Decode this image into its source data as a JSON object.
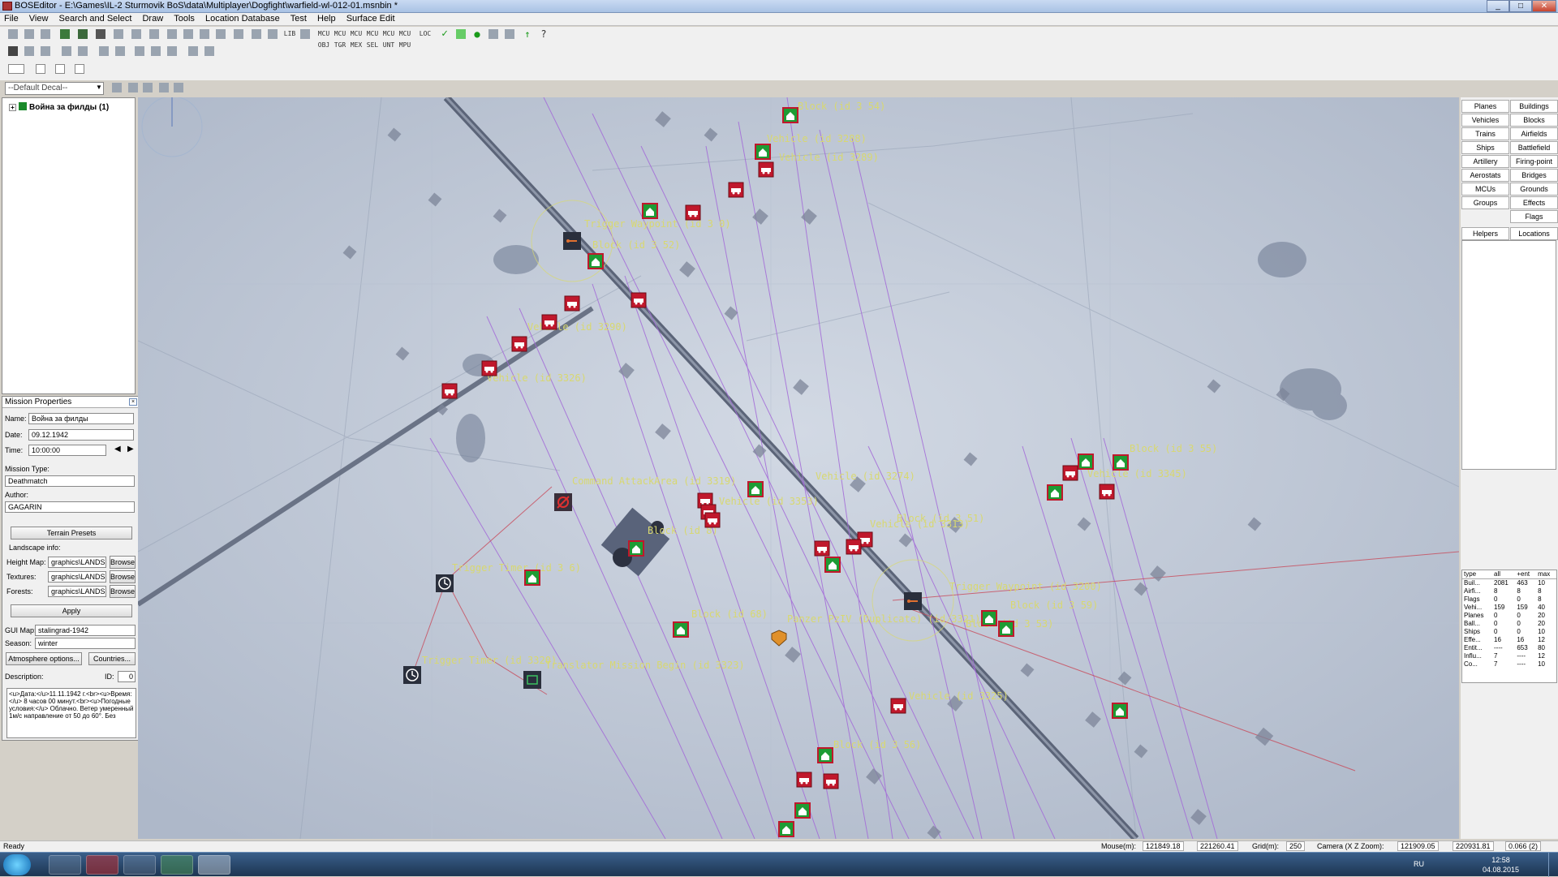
{
  "window": {
    "title": "BOSEditor - E:\\Games\\IL-2 Sturmovik BoS\\data\\Multiplayer\\Dogfight\\warfield-wl-012-01.msnbin *",
    "controls": [
      "_",
      "□",
      "✕"
    ]
  },
  "menu": [
    "File",
    "View",
    "Search and Select",
    "Draw",
    "Tools",
    "Location Database",
    "Test",
    "Help",
    "Surface Edit"
  ],
  "toolbar": {
    "mcu_labels": [
      "MCU OBJ",
      "MCU TGR",
      "MCU MEX",
      "MCU SEL",
      "MCU UNT",
      "MCU MPU"
    ],
    "misc_labels": [
      "LOC",
      "LIB"
    ]
  },
  "decal": {
    "value": "--Default Decal--"
  },
  "tree": {
    "root_label": "Война за филды (1)",
    "expander": "+"
  },
  "mission_properties": {
    "header": "Mission Properties",
    "name_label": "Name:",
    "name_value": "Война за филды",
    "date_label": "Date:",
    "date_value": "09.12.1942",
    "time_label": "Time:",
    "time_value": "10:00:00",
    "mission_type_label": "Mission Type:",
    "mission_type_value": "Deathmatch",
    "author_label": "Author:",
    "author_value": "GAGARIN",
    "terrain_presets_btn": "Terrain Presets",
    "landscape_info_label": "Landscape info:",
    "height_map_label": "Height Map:",
    "height_map_value": "graphics\\LANDSCA",
    "textures_label": "Textures:",
    "textures_value": "graphics\\LANDSCA",
    "forests_label": "Forests:",
    "forests_value": "graphics\\LANDSCA",
    "browse_label": "Browse",
    "apply_btn": "Apply",
    "gui_map_label": "GUI Map:",
    "gui_map_value": "stalingrad-1942",
    "season_label": "Season:",
    "season_value": "winter",
    "atmosphere_btn": "Atmosphere options...",
    "countries_btn": "Countries...",
    "description_label": "Description:",
    "id_label": "ID:",
    "id_value": "0",
    "description_text": "<u>Дата:</u>11.11.1942 г.<br><u>Время:</u> 8 часов 00 минут.<br><u>Погодные условия:</u> Облачно. Ветер умеренный 1м/с направление от 50 до 60°. Без"
  },
  "map_labels": {
    "block_354": "Block (id 3 54)",
    "block_352": "Block (id 3 52)",
    "block_355": "Block (id 3 55)",
    "block_353": "Block (id 3 53)",
    "trigger_wp_1": "Trigger Waypoint (id 3 0)",
    "trigger_wp_2": "Trigger Waypoint (id 3200)",
    "trigger_timer_1": "Trigger Timer (id 3 6)",
    "trigger_timer_2": "Trigger Timer (id 3320)",
    "cmd_attack": "Command AttackArea (id 3319)",
    "translator": "Translator Mission Begin (id 3323)",
    "panzer": "Panzer PzIV (Duplicate) (id 3321)",
    "vehicle_1": "Vehicle (id 3288)",
    "vehicle_2": "Vehicle (id 3289)",
    "vehicle_3": "Vehicle (id 3290)",
    "vehicle_4": "Vehicle (id 3326)",
    "vehicle_5": "Vehicle (id 3345)",
    "vehicle_6": "Vehicle (id 3274)",
    "vehicle_7": "Vehicle (id 3353)",
    "vehicle_8": "Vehicle (id 3325)",
    "vehicle_9": "Vehicle (id 3313)",
    "block_8": "Block (id 8)",
    "block_68": "Block (id 68)",
    "block_51": "Block (id 3 51)",
    "block_56": "Block (id 3 56)",
    "block_59": "Block (id 3 59)"
  },
  "category_buttons": [
    "Planes",
    "Buildings",
    "Vehicles",
    "Blocks",
    "Trains",
    "Airfields",
    "Ships",
    "Battlefield",
    "Artillery",
    "Firing-point",
    "Aerostats",
    "Bridges",
    "MCUs",
    "Grounds",
    "Groups",
    "Effects",
    "",
    "Flags",
    "Helpers",
    "Locations"
  ],
  "stats": {
    "headers": [
      "type",
      "all",
      "+ent",
      "max"
    ],
    "rows": [
      [
        "Buil...",
        "2081",
        "463",
        "10"
      ],
      [
        "Airfi...",
        "8",
        "8",
        "8"
      ],
      [
        "Flags",
        "0",
        "0",
        "8"
      ],
      [
        "Vehi...",
        "159",
        "159",
        "40"
      ],
      [
        "Planes",
        "0",
        "0",
        "20"
      ],
      [
        "Ball...",
        "0",
        "0",
        "20"
      ],
      [
        "Ships",
        "0",
        "0",
        "10"
      ],
      [
        "Effe...",
        "16",
        "16",
        "12"
      ],
      [
        "Entit...",
        "----",
        "653",
        "80"
      ],
      [
        "Influ...",
        "7",
        "----",
        "12"
      ],
      [
        "Co...",
        "7",
        "----",
        "10"
      ]
    ]
  },
  "statusbar": {
    "ready": "Ready",
    "mouse_label": "Mouse(m):",
    "mouse_x": "121849.18",
    "mouse_z": "221260.41",
    "grid_label": "Grid(m):",
    "grid_value": "250",
    "camera_label": "Camera (X Z Zoom):",
    "camera_x": "121909.05",
    "camera_z": "220931.81",
    "camera_zoom": "0.066 (2)"
  },
  "taskbar": {
    "lang": "RU",
    "time": "12:58",
    "date": "04.08.2015"
  },
  "colors": {
    "red_marker": "#c0182c",
    "green_marker": "#1d9c34",
    "label_yellow": "#d8d870",
    "path_violet": "#a36ad8"
  }
}
